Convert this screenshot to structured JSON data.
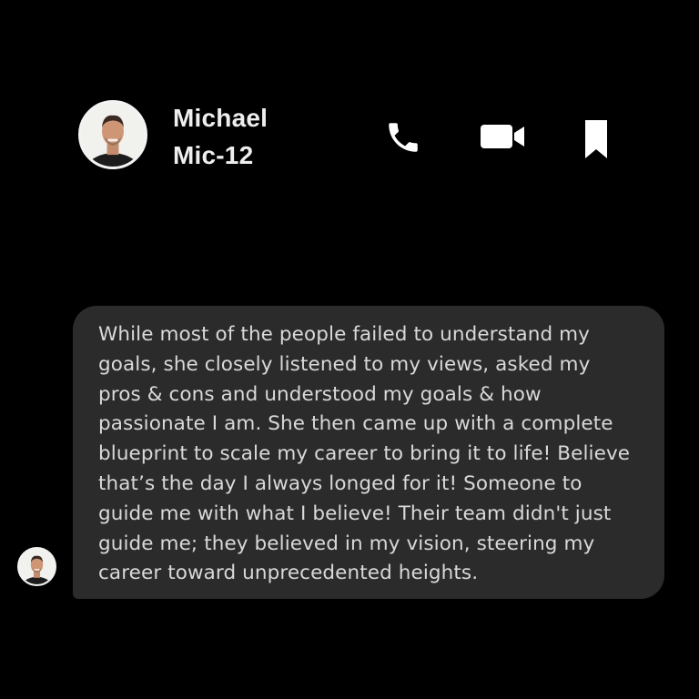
{
  "header": {
    "contact_name": "Michael",
    "contact_handle": "Mic-12",
    "avatar_icon": "avatar-icon",
    "actions": {
      "call_icon": "phone-icon",
      "video_icon": "video-camera-icon",
      "bookmark_icon": "bookmark-icon"
    }
  },
  "message": {
    "sender_avatar_icon": "avatar-icon",
    "text": "While most of the people failed to understand my goals, she closely listened to my views, asked my pros & cons and understood my goals & how passionate I am. She then came up with a complete blueprint to scale my career to bring it to life! Believe that’s the day I always longed for it! Someone to guide me with what I believe! Their team didn't just guide me; they believed in my vision, steering my career toward unprecedented heights."
  },
  "colors": {
    "background": "#000000",
    "bubble": "#2b2b2b",
    "text": "#d9d9d9",
    "icon": "#ffffff"
  }
}
